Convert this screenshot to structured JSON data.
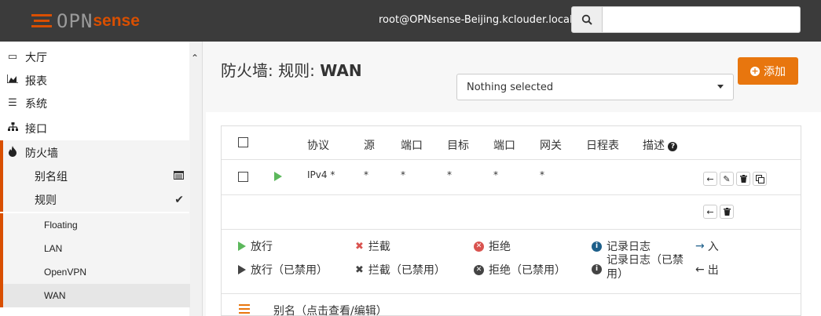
{
  "header": {
    "logo_opn": "OPN",
    "logo_sense": "sense",
    "user": "root@OPNsense-Beijing.kclouder.local",
    "search_placeholder": ""
  },
  "sidebar": {
    "items": [
      {
        "label": "大厅",
        "icon": "laptop-icon"
      },
      {
        "label": "报表",
        "icon": "area-chart-icon"
      },
      {
        "label": "系统",
        "icon": "server-icon"
      },
      {
        "label": "接口",
        "icon": "sitemap-icon"
      },
      {
        "label": "防火墙",
        "icon": "fire-icon"
      }
    ],
    "firewall_sub": [
      {
        "label": "别名组",
        "icon": "list-alt-icon"
      },
      {
        "label": "规则",
        "icon": "check-icon"
      }
    ],
    "rules_sub": [
      "Floating",
      "LAN",
      "OpenVPN",
      "WAN"
    ]
  },
  "page": {
    "title_prefix": "防火墙: 规则: ",
    "title_strong": "WAN",
    "select_value": "Nothing selected",
    "add_label": "添加"
  },
  "table": {
    "headers": [
      "协议",
      "源",
      "端口",
      "目标",
      "端口",
      "网关",
      "日程表",
      "描述"
    ],
    "row": {
      "protocol": "IPv4 *",
      "source": "*",
      "source_port": "*",
      "destination": "*",
      "destination_port": "*",
      "gateway": "*"
    }
  },
  "legend": {
    "pass": "放行",
    "pass_disabled": "放行（已禁用）",
    "block": "拦截",
    "block_disabled": "拦截（已禁用）",
    "reject": "拒绝",
    "reject_disabled": "拒绝（已禁用）",
    "log": "记录日志",
    "log_disabled_1": "记录日志（已禁",
    "log_disabled_2": "用）",
    "in": "入",
    "out": "出",
    "alias": "别名（点击查看/编辑）"
  },
  "colors": {
    "accent": "#d94f00",
    "add_button": "#e8760e",
    "pass": "#5cb85c",
    "block": "#d9534f",
    "info": "#1d5f8a"
  }
}
